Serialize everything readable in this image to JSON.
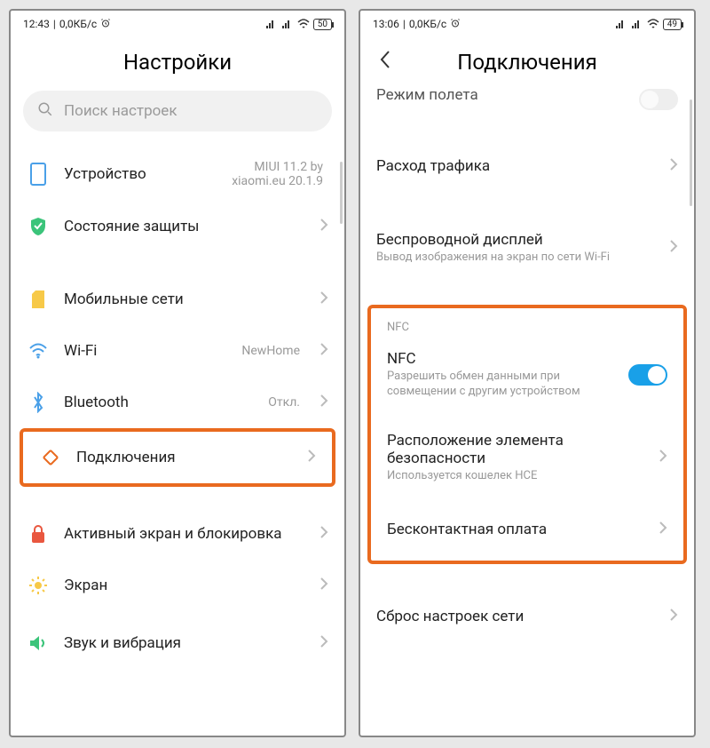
{
  "left": {
    "status": {
      "time": "12:43",
      "speed": "0,0КБ/с",
      "battery": "50"
    },
    "title": "Настройки",
    "search_placeholder": "Поиск настроек",
    "items": {
      "device": {
        "label": "Устройство",
        "value": "MIUI 11.2 by xiaomi.eu 20.1.9"
      },
      "security": {
        "label": "Состояние защиты"
      },
      "mobile": {
        "label": "Мобильные сети"
      },
      "wifi": {
        "label": "Wi-Fi",
        "value": "NewHome"
      },
      "bluetooth": {
        "label": "Bluetooth",
        "value": "Откл."
      },
      "connections": {
        "label": "Подключения"
      },
      "lockscreen": {
        "label": "Активный экран и блокировка"
      },
      "display": {
        "label": "Экран"
      },
      "sound": {
        "label": "Звук и вибрация"
      }
    }
  },
  "right": {
    "status": {
      "time": "13:06",
      "speed": "0,0КБ/с",
      "battery": "49"
    },
    "title": "Подключения",
    "cut_item": "Режим полета",
    "items": {
      "traffic": {
        "label": "Расход трафика"
      },
      "cast": {
        "label": "Беспроводной дисплей",
        "sub": "Вывод изображения на экран по сети Wi-Fi"
      },
      "nfc_section_label": "NFC",
      "nfc": {
        "label": "NFC",
        "sub": "Разрешить обмен данными при совмещении с другим устройством"
      },
      "secure": {
        "label": "Расположение элемента безопасности",
        "sub": "Используется кошелек HCE"
      },
      "tap_pay": {
        "label": "Бесконтактная оплата"
      },
      "reset": {
        "label": "Сброс настроек сети"
      }
    }
  }
}
